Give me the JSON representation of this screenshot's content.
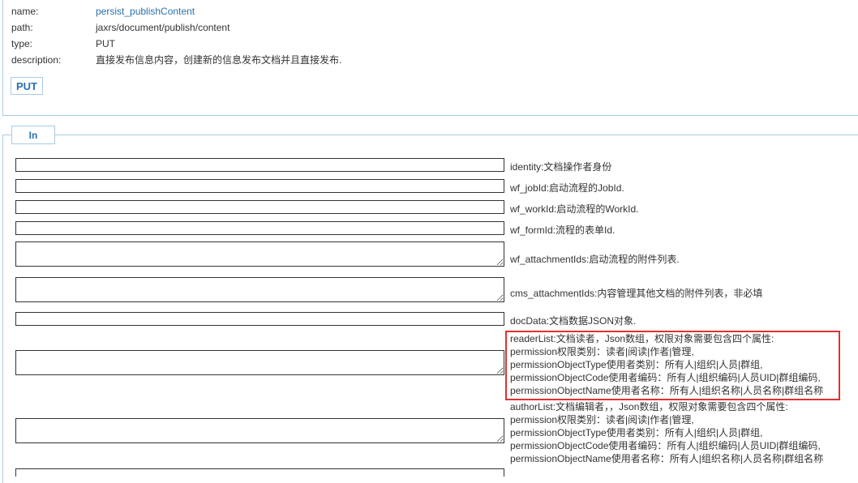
{
  "meta": {
    "name_label": "name:",
    "name_value": "persist_publishContent",
    "path_label": "path:",
    "path_value": "jaxrs/document/publish/content",
    "type_label": "type:",
    "type_value": "PUT",
    "description_label": "description:",
    "description_value": "直接发布信息内容，创建新的信息发布文档并且直接发布."
  },
  "method_button": "PUT",
  "in_tab": "In",
  "params": {
    "identity": "identity:文档操作者身份",
    "wf_jobId": "wf_jobId:启动流程的JobId.",
    "wf_workId": "wf_workId:启动流程的WorkId.",
    "wf_formId": "wf_formId:流程的表单Id.",
    "wf_attachmentIds": "wf_attachmentIds:启动流程的附件列表.",
    "cms_attachmentIds": "cms_attachmentIds:内容管理其他文档的附件列表，非必填",
    "docData": "docData:文档数据JSON对象.",
    "readerList": [
      "readerList:文档读者，Json数组，权限对象需要包含四个属性:",
      "permission权限类别：读者|阅读|作者|管理,",
      "permissionObjectType使用者类别：所有人|组织|人员|群组,",
      "permissionObjectCode使用者编码：所有人|组织编码|人员UID|群组编码,",
      "permissionObjectName使用者名称：所有人|组织名称|人员名称|群组名称"
    ],
    "authorList": [
      "authorList:文档编辑者，，Json数组，权限对象需要包含四个属性:",
      "permission权限类别：读者|阅读|作者|管理,",
      "permissionObjectType使用者类别：所有人|组织|人员|群组,",
      "permissionObjectCode使用者编码：所有人|组织编码|人员UID|群组编码,",
      "permissionObjectName使用者名称：所有人|组织名称|人员名称|群组名称"
    ]
  },
  "colors": {
    "accent": "#2a6fad",
    "border": "#a9cbe6",
    "highlight": "#e03131"
  }
}
